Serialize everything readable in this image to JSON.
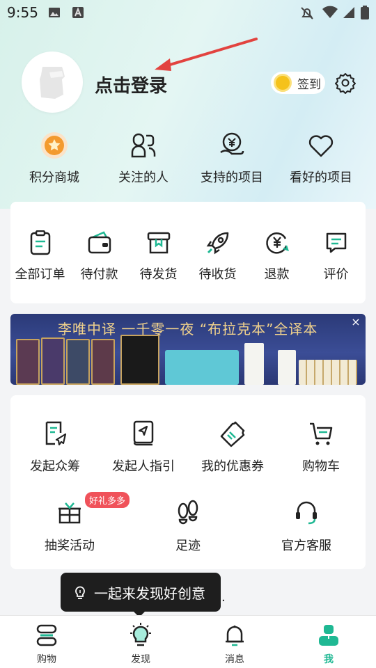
{
  "status_bar": {
    "time": "9:55"
  },
  "profile": {
    "login_label": "点击登录",
    "checkin_label": "签到"
  },
  "quick_links": [
    {
      "label": "积分商城",
      "icon": "points-mall-icon"
    },
    {
      "label": "关注的人",
      "icon": "following-people-icon"
    },
    {
      "label": "支持的项目",
      "icon": "supported-projects-icon"
    },
    {
      "label": "看好的项目",
      "icon": "liked-projects-icon"
    }
  ],
  "orders": [
    {
      "label": "全部订单",
      "icon": "all-orders-icon"
    },
    {
      "label": "待付款",
      "icon": "wallet-icon"
    },
    {
      "label": "待发货",
      "icon": "box-icon"
    },
    {
      "label": "待收货",
      "icon": "rocket-icon"
    },
    {
      "label": "退款",
      "icon": "refund-icon"
    },
    {
      "label": "评价",
      "icon": "review-icon"
    }
  ],
  "banner": {
    "text": "李唯中译  一千零一夜  “布拉克本”全译本"
  },
  "tools": [
    {
      "label": "发起众筹",
      "icon": "crowdfund-icon"
    },
    {
      "label": "发起人指引",
      "icon": "guide-book-icon"
    },
    {
      "label": "我的优惠券",
      "icon": "coupon-icon"
    },
    {
      "label": "购物车",
      "icon": "cart-icon"
    },
    {
      "label": "抽奖活动",
      "icon": "gift-icon"
    },
    {
      "label": "足迹",
      "icon": "footprints-icon"
    },
    {
      "label": "官方客服",
      "icon": "headset-icon"
    }
  ],
  "gift_badge": "好礼多多",
  "tooltip": {
    "text": "一起来发现好创意",
    "trailing": "."
  },
  "tabbar": [
    {
      "label": "购物",
      "icon": "shopping-icon"
    },
    {
      "label": "发现",
      "icon": "discover-bulb-icon"
    },
    {
      "label": "消息",
      "icon": "bell-icon"
    },
    {
      "label": "我",
      "icon": "me-icon"
    }
  ],
  "colors": {
    "accent": "#1fb893",
    "badge": "#f0525a",
    "coin": "#f5c21a"
  }
}
